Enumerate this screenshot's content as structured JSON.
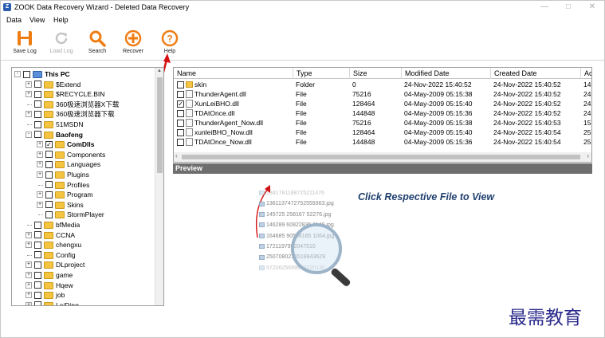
{
  "window": {
    "title": "ZOOK Data Recovery Wizard - Deleted Data Recovery"
  },
  "menu": [
    "Data",
    "View",
    "Help"
  ],
  "toolbar": [
    {
      "label": "Save Log",
      "icon": "save-log-icon",
      "enabled": true
    },
    {
      "label": "Load Log",
      "icon": "load-log-icon",
      "enabled": false
    },
    {
      "label": "Search",
      "icon": "search-icon",
      "enabled": true
    },
    {
      "label": "Recover",
      "icon": "recover-icon",
      "enabled": true
    },
    {
      "label": "Help",
      "icon": "help-icon",
      "enabled": true
    }
  ],
  "tree": [
    {
      "label": "This PC",
      "level": 0,
      "expander": "-",
      "check": "",
      "bold": true,
      "pc": true
    },
    {
      "label": "$Extend",
      "level": 1,
      "expander": "+",
      "check": ""
    },
    {
      "label": "$RECYCLE.BIN",
      "level": 1,
      "expander": "+",
      "check": ""
    },
    {
      "label": "360极速浏览器X下载",
      "level": 1,
      "expander": "",
      "check": ""
    },
    {
      "label": "360极速浏览器下载",
      "level": 1,
      "expander": "+",
      "check": ""
    },
    {
      "label": "51MSDN",
      "level": 1,
      "expander": "",
      "check": ""
    },
    {
      "label": "Baofeng",
      "level": 1,
      "expander": "-",
      "check": "",
      "bold": true
    },
    {
      "label": "ComDlls",
      "level": 2,
      "expander": "+",
      "check": "✓",
      "bold": true
    },
    {
      "label": "Components",
      "level": 2,
      "expander": "+",
      "check": ""
    },
    {
      "label": "Languages",
      "level": 2,
      "expander": "+",
      "check": ""
    },
    {
      "label": "Plugins",
      "level": 2,
      "expander": "+",
      "check": ""
    },
    {
      "label": "Profiles",
      "level": 2,
      "expander": "",
      "check": ""
    },
    {
      "label": "Program",
      "level": 2,
      "expander": "+",
      "check": ""
    },
    {
      "label": "Skins",
      "level": 2,
      "expander": "+",
      "check": ""
    },
    {
      "label": "StormPlayer",
      "level": 2,
      "expander": "",
      "check": ""
    },
    {
      "label": "bfMedia",
      "level": 1,
      "expander": "",
      "check": ""
    },
    {
      "label": "CCNA",
      "level": 1,
      "expander": "+",
      "check": ""
    },
    {
      "label": "chengxu",
      "level": 1,
      "expander": "+",
      "check": ""
    },
    {
      "label": "Config",
      "level": 1,
      "expander": "",
      "check": ""
    },
    {
      "label": "DLproject",
      "level": 1,
      "expander": "+",
      "check": ""
    },
    {
      "label": "game",
      "level": 1,
      "expander": "+",
      "check": ""
    },
    {
      "label": "Hqew",
      "level": 1,
      "expander": "+",
      "check": ""
    },
    {
      "label": "job",
      "level": 1,
      "expander": "+",
      "check": ""
    },
    {
      "label": "LeiDing",
      "level": 1,
      "expander": "+",
      "check": ""
    }
  ],
  "columns": [
    "Name",
    "Type",
    "Size",
    "Modified Date",
    "Created Date",
    "Ac"
  ],
  "files": [
    {
      "name": "skin",
      "type": "Folder",
      "size": "0",
      "modified": "24-Nov-2022 15:40:52",
      "created": "24-Nov-2022 15:40:52",
      "ac": "14",
      "checked": "",
      "folder": true
    },
    {
      "name": "ThunderAgent.dll",
      "type": "File",
      "size": "75216",
      "modified": "04-May-2009 05:15:38",
      "created": "24-Nov-2022 15:40:52",
      "ac": "24",
      "checked": ""
    },
    {
      "name": "XunLeiBHO.dll",
      "type": "File",
      "size": "128464",
      "modified": "04-May-2009 05:15:40",
      "created": "24-Nov-2022 15:40:52",
      "ac": "24",
      "checked": "✓"
    },
    {
      "name": "TDAtOnce.dll",
      "type": "File",
      "size": "144848",
      "modified": "04-May-2009 05:15:36",
      "created": "24-Nov-2022 15:40:52",
      "ac": "24",
      "checked": ""
    },
    {
      "name": "ThunderAgent_Now.dll",
      "type": "File",
      "size": "75216",
      "modified": "04-May-2009 05:15:38",
      "created": "24-Nov-2022 15:40:53",
      "ac": "15",
      "checked": ""
    },
    {
      "name": "xunleiBHO_Now.dll",
      "type": "File",
      "size": "128464",
      "modified": "04-May-2009 05:15:40",
      "created": "24-Nov-2022 15:40:54",
      "ac": "25",
      "checked": ""
    },
    {
      "name": "TDAtOnce_Now.dll",
      "type": "File",
      "size": "144848",
      "modified": "04-May-2009 05:15:36",
      "created": "24-Nov-2022 15:40:54",
      "ac": "25",
      "checked": ""
    }
  ],
  "preview": {
    "title": "Preview",
    "hint": "Click Respective File to View",
    "sample_files": [
      "1341781188725211476",
      "1361137472752559363.jpg",
      "145725 258167 52276.jpg",
      "146289 60822835 1149.jpg",
      "164685 90508185 1064.jpg",
      "1721197952047510",
      "2507080276518843629",
      "5720625699983220130"
    ]
  },
  "watermark": "最需教育",
  "colors": {
    "accent": "#1f3f6e",
    "toolbar_icon": "#f07d14",
    "annotation": "#d41111",
    "preview_bar": "#6e6e6e"
  }
}
